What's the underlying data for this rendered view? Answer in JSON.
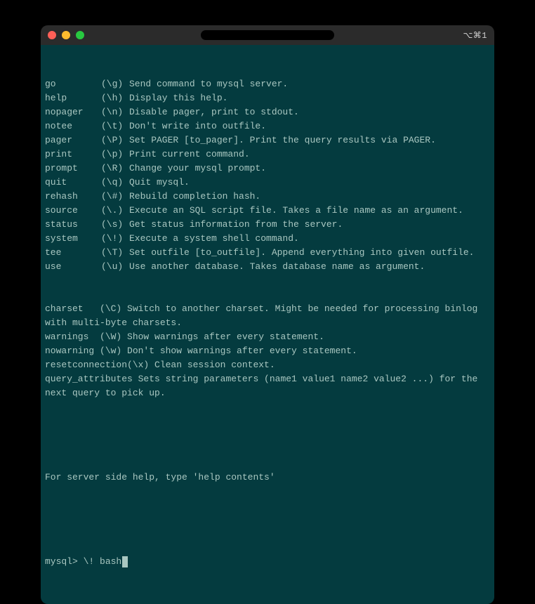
{
  "titlebar": {
    "right_label": "⌥⌘1"
  },
  "help": {
    "rows": [
      {
        "cmd": "go",
        "short": "(\\g)",
        "desc": "Send command to mysql server."
      },
      {
        "cmd": "help",
        "short": "(\\h)",
        "desc": "Display this help."
      },
      {
        "cmd": "nopager",
        "short": "(\\n)",
        "desc": "Disable pager, print to stdout."
      },
      {
        "cmd": "notee",
        "short": "(\\t)",
        "desc": "Don't write into outfile."
      },
      {
        "cmd": "pager",
        "short": "(\\P)",
        "desc": "Set PAGER [to_pager]. Print the query results via PAGER."
      },
      {
        "cmd": "print",
        "short": "(\\p)",
        "desc": "Print current command."
      },
      {
        "cmd": "prompt",
        "short": "(\\R)",
        "desc": "Change your mysql prompt."
      },
      {
        "cmd": "quit",
        "short": "(\\q)",
        "desc": "Quit mysql."
      },
      {
        "cmd": "rehash",
        "short": "(\\#)",
        "desc": "Rebuild completion hash."
      },
      {
        "cmd": "source",
        "short": "(\\.)",
        "desc": "Execute an SQL script file. Takes a file name as an argument."
      },
      {
        "cmd": "status",
        "short": "(\\s)",
        "desc": "Get status information from the server."
      },
      {
        "cmd": "system",
        "short": "(\\!)",
        "desc": "Execute a system shell command."
      },
      {
        "cmd": "tee",
        "short": "(\\T)",
        "desc": "Set outfile [to_outfile]. Append everything into given outfile."
      },
      {
        "cmd": "use",
        "short": "(\\u)",
        "desc": "Use another database. Takes database name as argument."
      }
    ],
    "wrapped": [
      "charset   (\\C) Switch to another charset. Might be needed for processing binlog with multi-byte charsets.",
      "warnings  (\\W) Show warnings after every statement.",
      "nowarning (\\w) Don't show warnings after every statement.",
      "resetconnection(\\x) Clean session context.",
      "query_attributes Sets string parameters (name1 value1 name2 value2 ...) for the next query to pick up."
    ],
    "footer": "For server side help, type 'help contents'"
  },
  "prompt": {
    "prefix": "mysql> ",
    "input": "\\! bash"
  }
}
